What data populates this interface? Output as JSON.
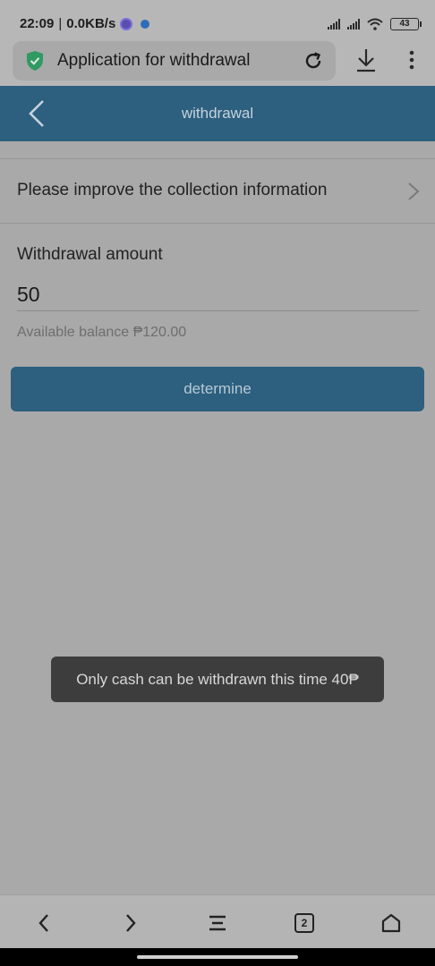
{
  "status_bar": {
    "time": "22:09",
    "speed": "0.0KB/s",
    "battery": "43"
  },
  "browser": {
    "page_title": "Application for withdrawal",
    "tab_count": "2"
  },
  "header": {
    "title": "withdrawal"
  },
  "collection": {
    "label": "Please improve the collection information"
  },
  "withdrawal": {
    "amount_label": "Withdrawal amount",
    "amount_value": "50",
    "balance_text": "Available balance ₱120.00"
  },
  "actions": {
    "determine_label": "determine"
  },
  "toast": {
    "message": "Only cash can be withdrawn this time 40₱"
  },
  "colors": {
    "header": "#2d5f7f",
    "button": "#2d5f7f",
    "toast": "#3d3d3d",
    "shield": "#2f9a62"
  },
  "icons": {
    "status": [
      "signal-icon",
      "wifi-icon",
      "battery-icon"
    ],
    "browser": [
      "shield-icon",
      "reload-icon",
      "download-icon",
      "more-menu-icon"
    ],
    "nav": [
      "nav-back-icon",
      "nav-forward-icon",
      "nav-menu-icon",
      "nav-tabs-icon",
      "nav-home-icon"
    ]
  }
}
